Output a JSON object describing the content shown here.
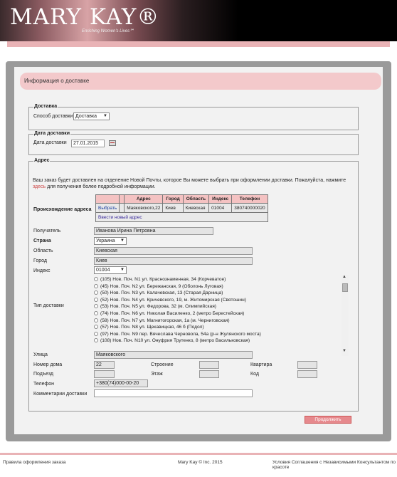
{
  "header": {
    "logo": "MARY KAY®",
    "tagline": "Enriching Women's Lives℠"
  },
  "page": {
    "title": "Информация о доставке"
  },
  "delivery": {
    "legend": "Доставка",
    "method_label": "Способ доставки",
    "method_value": "Доставка"
  },
  "delivery_date": {
    "legend": "Дата доставки",
    "label": "Дата доставки",
    "value": "27.01.2015"
  },
  "address": {
    "legend": "Адрес",
    "note": "Ваш заказ будет доставлен на отделение Новой Почты, которое Вы можете выбрать при оформлении доставки. Пожалуйста, нажмите",
    "note_link": "здесь",
    "note_end": "для получения более подробной информации.",
    "origin_label": "Происхождение адреса",
    "table_headers": [
      "Адрес",
      "Город",
      "Область",
      "Индекс",
      "Телефон"
    ],
    "row": {
      "select": "Выбрать",
      "address": "Маяковского,22",
      "city": "Киев",
      "region": "Киевская",
      "index": "01004",
      "phone": "380740000020"
    },
    "new_address": "Ввести новый адрес",
    "recipient_label": "Получатель",
    "recipient_value": "Иванова Ирина Петровна",
    "country_label": "Страна",
    "country_value": "Украина",
    "region_label": "Область",
    "region_value": "Киевская",
    "city_label": "Город",
    "city_value": "Киев",
    "index_label": "Индекс",
    "index_value": "01004",
    "type_label": "Тип доставки",
    "types": [
      "(105) Нов. Поч. N1 ул. Краснознаменная, 34 (Корчеватое)",
      "(45) Нов. Поч. N2 ул. Бережанская, 9 (Оболонь Луговая)",
      "(50) Нов. Поч. N3 ул. Калачевская, 13 (Старая Дарница)",
      "(52) Нов. Поч. N4 ул. Кричевского, 19, м. Житомирская (Святошин)",
      "(53) Нов. Поч. N5 ул. Федорова, 32 (м. Олимпийская)",
      "(74) Нов. Поч. N6 ул. Николая Василенко, 2 (метро Берестейская)",
      "(58) Нов. Поч. N7 ул. Магнитогорская, 1а (м. Черниговская)",
      "(57) Нов. Поч. N8 ул. Щекавицкая, 46 б (Подол)",
      "(97) Нов. Поч. N9 пер. Вячеслава Черновола, 54а (р-н Жулянского моста)",
      "(108) Нов. Поч. N10 ул. Онуфрия Трутенко, 8 (метро Васильковская)"
    ],
    "street_label": "Улица",
    "street_value": "Маяковского",
    "house_label": "Номер дома",
    "house_value": "22",
    "building_label": "Строение",
    "apt_label": "Квартира",
    "entrance_label": "Подъезд",
    "floor_label": "Этаж",
    "code_label": "Код",
    "phone_label": "Телефон",
    "phone_value": "+380(74)000-00-20",
    "comments_label": "Комментарии доставки"
  },
  "buttons": {
    "continue": "Продолжить"
  },
  "footer": {
    "left": "Правила оформления заказа",
    "middle": "Mary Kay © Inc. 2015",
    "right": "Условия Соглашения с Независимыми Консультантом по красоте"
  },
  "colors": {
    "pink": "#e9b3b6",
    "button": "#e6898d",
    "link": "#1a3fa0"
  },
  "icons": [
    "calendar-icon",
    "chevron-down-icon",
    "radio-button",
    "scroll-up-icon",
    "scroll-down-icon"
  ]
}
